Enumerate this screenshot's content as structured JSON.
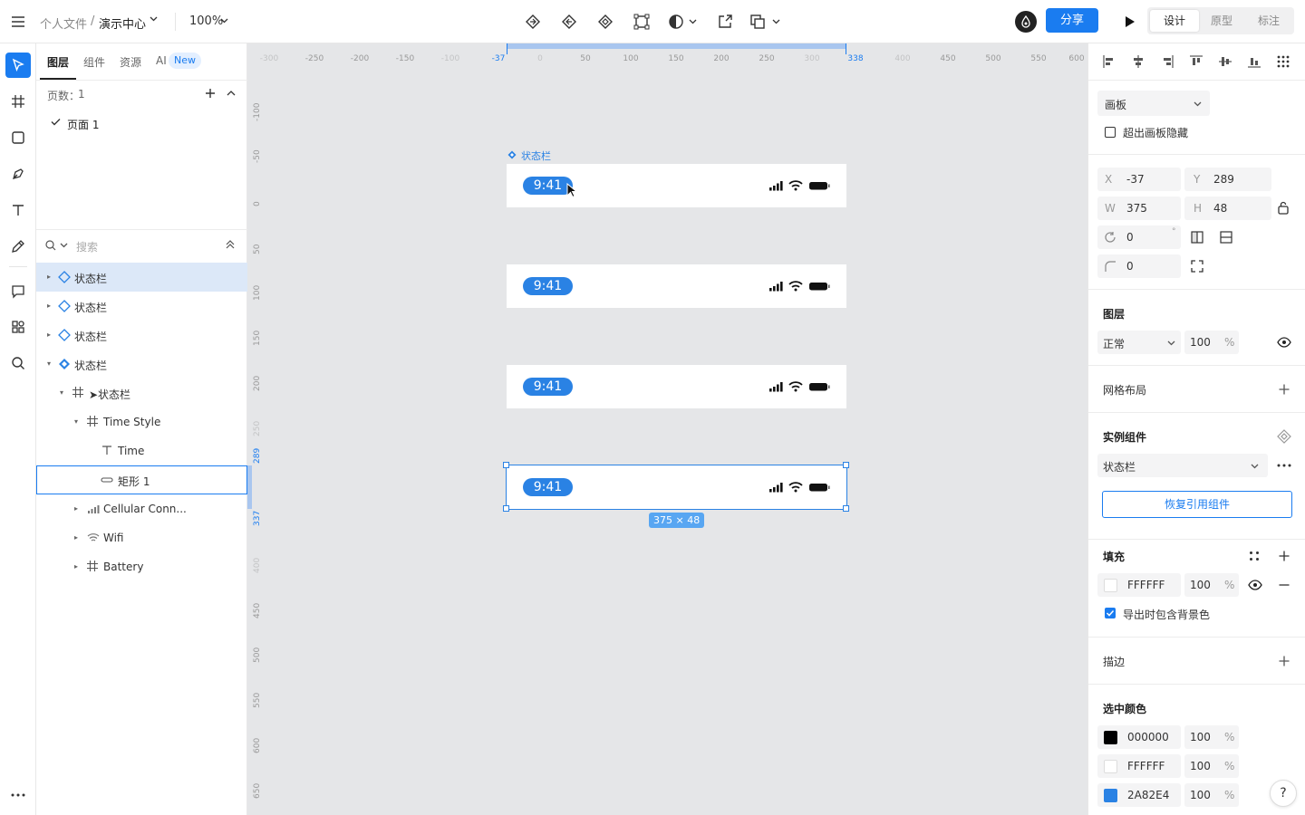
{
  "topbar": {
    "crumb_parent": "个人文件",
    "crumb_sep": "/",
    "crumb_current": "演示中心",
    "zoom": "100%",
    "share": "分享",
    "mode_tabs": [
      "设计",
      "原型",
      "标注"
    ]
  },
  "layers_panel": {
    "tabs": [
      "图层",
      "组件",
      "资源",
      "AI"
    ],
    "ai_badge": "New",
    "pages_label": "页数：",
    "pages_count": "1",
    "page_name": "页面 1",
    "search_placeholder": "搜索",
    "layers": [
      {
        "label": "状态栏"
      },
      {
        "label": "状态栏"
      },
      {
        "label": "状态栏"
      },
      {
        "label": "状态栏"
      },
      {
        "label": "➤状态栏"
      },
      {
        "label": "Time Style"
      },
      {
        "label": "Time"
      },
      {
        "label": "矩形 1"
      },
      {
        "label": "Cellular Conn..."
      },
      {
        "label": "Wifi"
      },
      {
        "label": "Battery"
      }
    ]
  },
  "canvas": {
    "ruler_x": [
      "-300",
      "-250",
      "-200",
      "-150",
      "-100",
      "-37",
      "0",
      "50",
      "100",
      "150",
      "200",
      "250",
      "300",
      "338",
      "400",
      "450",
      "500",
      "550",
      "600"
    ],
    "ruler_y": [
      "-100",
      "-50",
      "0",
      "50",
      "100",
      "150",
      "200",
      "250",
      "289",
      "337",
      "400",
      "450",
      "500",
      "550",
      "600",
      "650"
    ],
    "frame_label": "状态栏",
    "time": "9:41",
    "size_badge": "375 × 48"
  },
  "properties": {
    "frame_type": "画板",
    "clip_label": "超出画板隐藏",
    "x_label": "X",
    "x": "-37",
    "y_label": "Y",
    "y": "289",
    "w_label": "W",
    "w": "375",
    "h_label": "H",
    "h": "48",
    "rotation": "0",
    "degree": "°",
    "radius": "0",
    "layer_title": "图层",
    "blend": "正常",
    "opacity": "100",
    "percent": "%",
    "grid_title": "网格布局",
    "instance_title": "实例组件",
    "instance_name": "状态栏",
    "restore_btn": "恢复引用组件",
    "fill_title": "填充",
    "fill_hex": "FFFFFF",
    "fill_opacity": "100",
    "export_bg": "导出时包含背景色",
    "stroke_title": "描边",
    "selected_colors_title": "选中颜色",
    "selected_colors": [
      {
        "hex": "000000",
        "opacity": "100",
        "swatch": "#000000"
      },
      {
        "hex": "FFFFFF",
        "opacity": "100",
        "swatch": "#FFFFFF"
      },
      {
        "hex": "2A82E4",
        "opacity": "100",
        "swatch": "#2A82E4"
      }
    ],
    "help": "?"
  },
  "colors": {
    "accent": "#1a7cf0",
    "selection": "#dce8f8",
    "pill": "#2a82e4"
  }
}
